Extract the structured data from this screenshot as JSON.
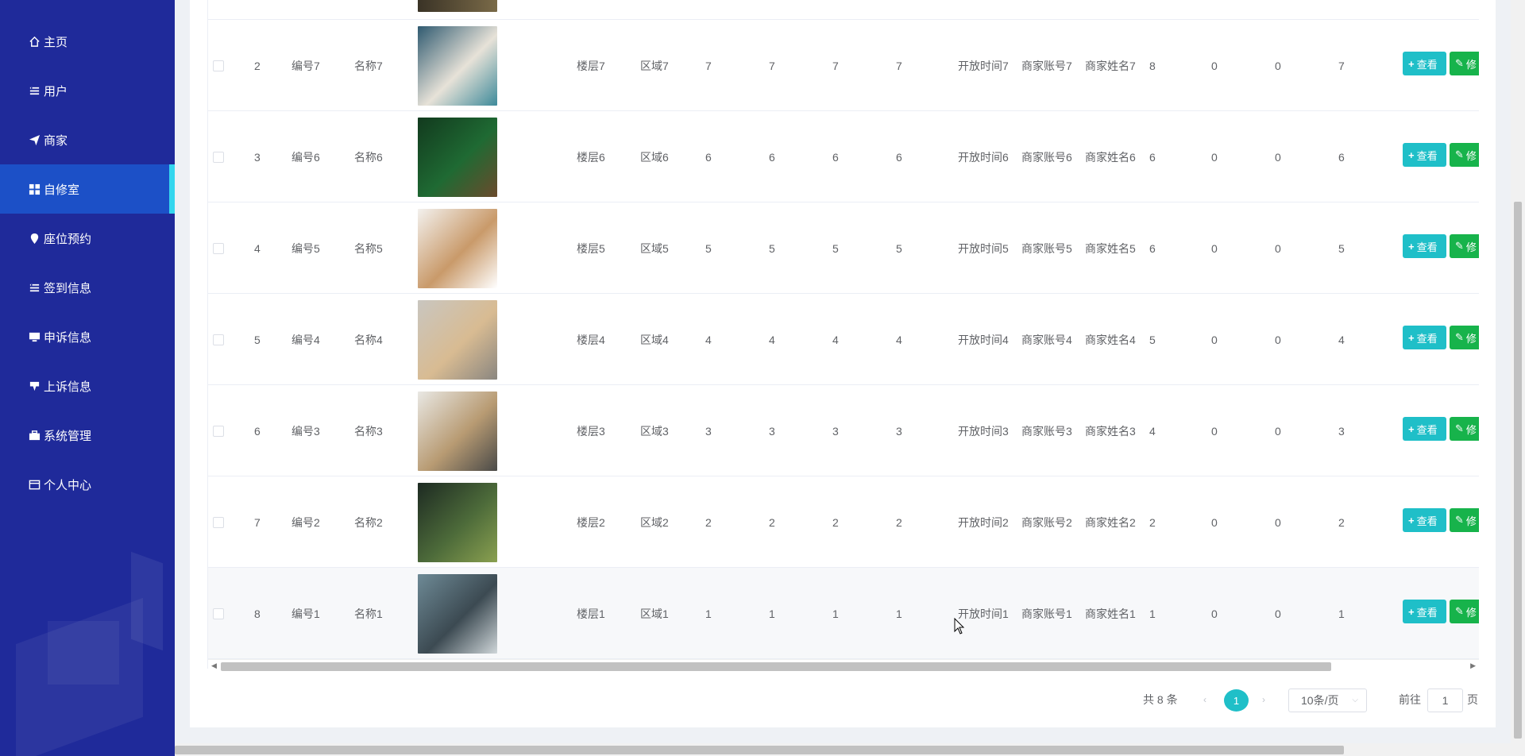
{
  "sidebar": {
    "items": [
      {
        "label": "主页",
        "icon": "home-icon"
      },
      {
        "label": "用户",
        "icon": "list-icon"
      },
      {
        "label": "商家",
        "icon": "send-icon"
      },
      {
        "label": "自修室",
        "icon": "grid-icon",
        "active": true
      },
      {
        "label": "座位预约",
        "icon": "pin-icon"
      },
      {
        "label": "签到信息",
        "icon": "list-icon"
      },
      {
        "label": "申诉信息",
        "icon": "monitor-icon"
      },
      {
        "label": "上诉信息",
        "icon": "flag-icon"
      },
      {
        "label": "系统管理",
        "icon": "briefcase-icon"
      },
      {
        "label": "个人中心",
        "icon": "card-icon"
      }
    ]
  },
  "table": {
    "rows": [
      {
        "index": "2",
        "code": "编号7",
        "name": "名称7",
        "floor": "楼层7",
        "area": "区域7",
        "c1": "7",
        "c2": "7",
        "c3": "7",
        "c4": "7",
        "open_time": "开放时间7",
        "account": "商家账号7",
        "merchant_name": "商家姓名7",
        "c5": "8",
        "c6": "0",
        "c7": "0",
        "c8": "7",
        "image_colors": [
          "#2f5a70",
          "#e7e2d8",
          "#3e8a9a"
        ]
      },
      {
        "index": "3",
        "code": "编号6",
        "name": "名称6",
        "floor": "楼层6",
        "area": "区域6",
        "c1": "6",
        "c2": "6",
        "c3": "6",
        "c4": "6",
        "open_time": "开放时间6",
        "account": "商家账号6",
        "merchant_name": "商家姓名6",
        "c5": "6",
        "c6": "0",
        "c7": "0",
        "c8": "6",
        "image_colors": [
          "#123a1e",
          "#1f6a33",
          "#6b4a2c"
        ]
      },
      {
        "index": "4",
        "code": "编号5",
        "name": "名称5",
        "floor": "楼层5",
        "area": "区域5",
        "c1": "5",
        "c2": "5",
        "c3": "5",
        "c4": "5",
        "open_time": "开放时间5",
        "account": "商家账号5",
        "merchant_name": "商家姓名5",
        "c5": "6",
        "c6": "0",
        "c7": "0",
        "c8": "5",
        "image_colors": [
          "#f3f1ee",
          "#c99a6a",
          "#ffffff"
        ]
      },
      {
        "index": "5",
        "code": "编号4",
        "name": "名称4",
        "floor": "楼层4",
        "area": "区域4",
        "c1": "4",
        "c2": "4",
        "c3": "4",
        "c4": "4",
        "open_time": "开放时间4",
        "account": "商家账号4",
        "merchant_name": "商家姓名4",
        "c5": "5",
        "c6": "0",
        "c7": "0",
        "c8": "4",
        "image_colors": [
          "#c9c6c0",
          "#d8bb92",
          "#8a8680"
        ]
      },
      {
        "index": "6",
        "code": "编号3",
        "name": "名称3",
        "floor": "楼层3",
        "area": "区域3",
        "c1": "3",
        "c2": "3",
        "c3": "3",
        "c4": "3",
        "open_time": "开放时间3",
        "account": "商家账号3",
        "merchant_name": "商家姓名3",
        "c5": "4",
        "c6": "0",
        "c7": "0",
        "c8": "3",
        "image_colors": [
          "#e9e8e4",
          "#b89b73",
          "#4a4a48"
        ]
      },
      {
        "index": "7",
        "code": "编号2",
        "name": "名称2",
        "floor": "楼层2",
        "area": "区域2",
        "c1": "2",
        "c2": "2",
        "c3": "2",
        "c4": "2",
        "open_time": "开放时间2",
        "account": "商家账号2",
        "merchant_name": "商家姓名2",
        "c5": "2",
        "c6": "0",
        "c7": "0",
        "c8": "2",
        "image_colors": [
          "#1d2a22",
          "#4d6b3a",
          "#8aa050"
        ]
      },
      {
        "index": "8",
        "code": "编号1",
        "name": "名称1",
        "floor": "楼层1",
        "area": "区域1",
        "c1": "1",
        "c2": "1",
        "c3": "1",
        "c4": "1",
        "open_time": "开放时间1",
        "account": "商家账号1",
        "merchant_name": "商家姓名1",
        "c5": "1",
        "c6": "0",
        "c7": "0",
        "c8": "1",
        "image_colors": [
          "#6e8a96",
          "#3c4a52",
          "#cfd6d9"
        ]
      }
    ],
    "view_label": "查看",
    "edit_label": "修"
  },
  "pagination": {
    "total": "共 8 条",
    "current_page": "1",
    "page_size": "10条/页",
    "goto_prefix": "前往",
    "goto_value": "1",
    "goto_suffix": "页"
  },
  "colors": {
    "sidebar_bg": "#1f2a9a",
    "sidebar_active": "#1c50c7",
    "accent": "#1fbfc8",
    "edit_button": "#17b34b"
  }
}
